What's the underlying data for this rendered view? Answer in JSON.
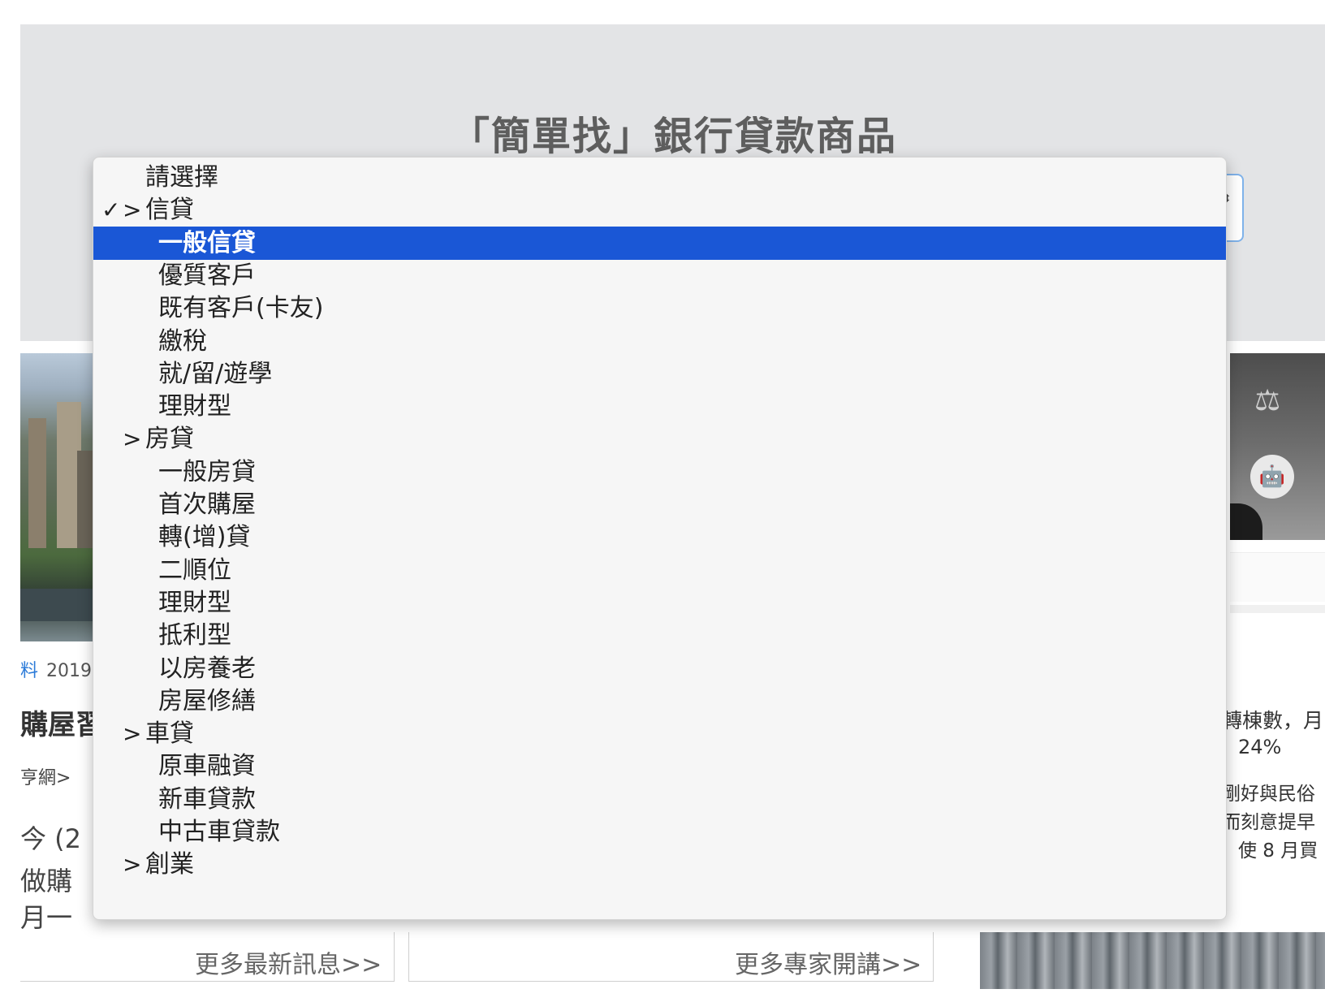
{
  "banner": {
    "title": "「簡單找」銀行貸款商品",
    "select_arrows": "⬍"
  },
  "background": {
    "left_date_tag": "料",
    "left_date": "2019-",
    "left_headline": "購屋習",
    "left_source": "亨網>",
    "left_para_1": "今 (2",
    "left_para_2": "做購",
    "left_para_3": "月一",
    "right_line_1": "轉棟數，月",
    "right_line_2": "24%",
    "right_line_3": "剛好與民俗",
    "right_line_4": "而刻意提早",
    "right_line_5": "使 8 月買",
    "more_news_link": "更多最新訊息>>",
    "more_expert_link": "更多專家開講>>"
  },
  "dropdown": {
    "checkmark": "✓",
    "caret": ">",
    "options": [
      {
        "label": "請選擇",
        "type": "placeholder"
      },
      {
        "label": "信貸",
        "type": "group",
        "checked": true
      },
      {
        "label": "一般信貸",
        "type": "item",
        "selected": true
      },
      {
        "label": "優質客戶",
        "type": "item"
      },
      {
        "label": "既有客戶(卡友)",
        "type": "item"
      },
      {
        "label": "繳稅",
        "type": "item"
      },
      {
        "label": "就/留/遊學",
        "type": "item"
      },
      {
        "label": "理財型",
        "type": "item"
      },
      {
        "label": "房貸",
        "type": "group"
      },
      {
        "label": "一般房貸",
        "type": "item"
      },
      {
        "label": "首次購屋",
        "type": "item"
      },
      {
        "label": "轉(增)貸",
        "type": "item"
      },
      {
        "label": "二順位",
        "type": "item"
      },
      {
        "label": "理財型",
        "type": "item"
      },
      {
        "label": "抵利型",
        "type": "item"
      },
      {
        "label": "以房養老",
        "type": "item"
      },
      {
        "label": "房屋修繕",
        "type": "item"
      },
      {
        "label": "車貸",
        "type": "group"
      },
      {
        "label": "原車融資",
        "type": "item"
      },
      {
        "label": "新車貸款",
        "type": "item"
      },
      {
        "label": "中古車貸款",
        "type": "item"
      },
      {
        "label": "創業",
        "type": "group"
      }
    ]
  }
}
